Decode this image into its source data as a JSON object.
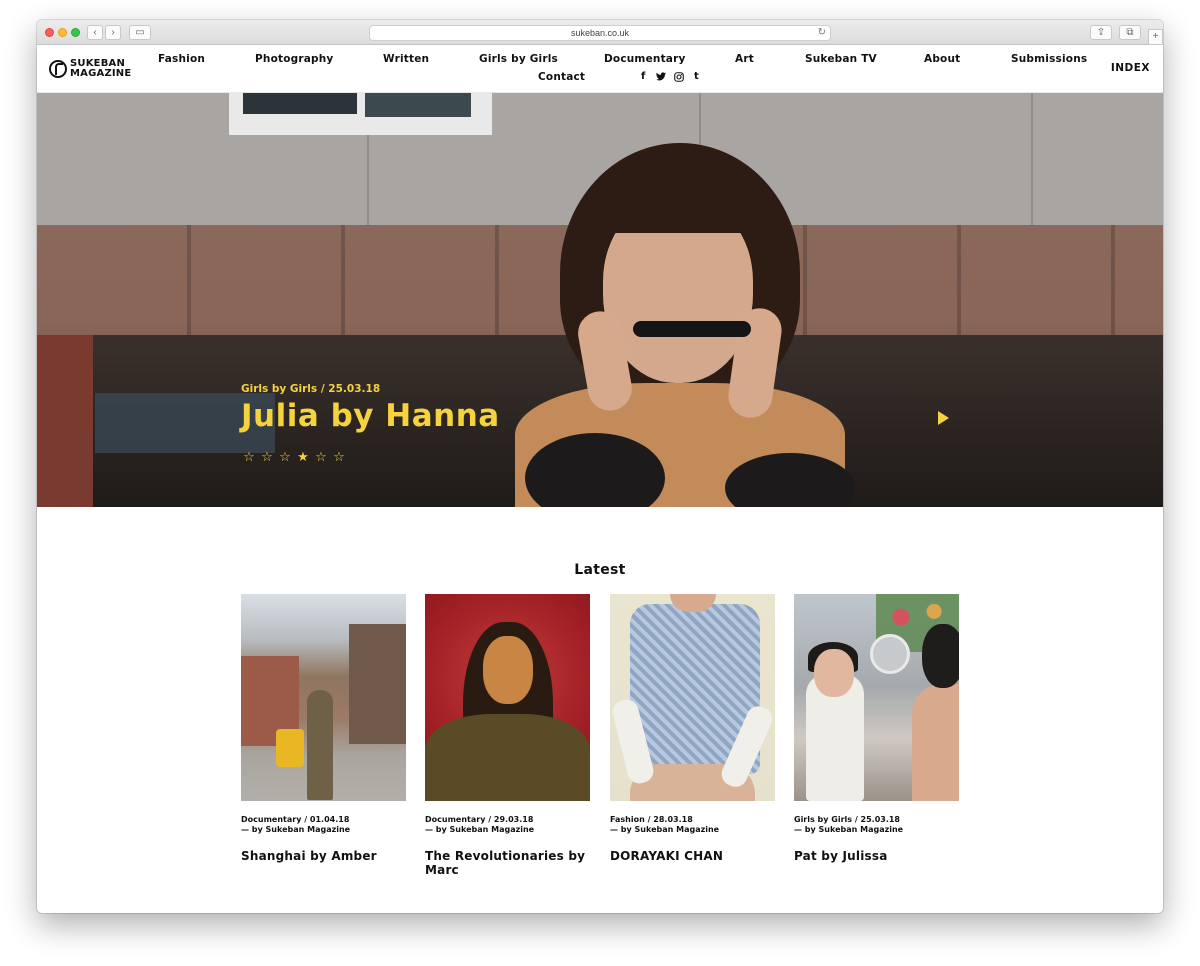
{
  "browser": {
    "url": "sukeban.co.uk"
  },
  "site": {
    "logo_line1": "SUKEBAN",
    "logo_line2": "MAGAZINE",
    "nav": [
      "Fashion",
      "Photography",
      "Written",
      "Girls by Girls",
      "Documentary",
      "Art",
      "Sukeban TV",
      "About",
      "Submissions",
      "Contact"
    ],
    "social": [
      "f",
      "twitter-bird",
      "instagram",
      "t"
    ],
    "index_label": "INDEX"
  },
  "hero": {
    "meta": "Girls by Girls / 25.03.18",
    "title": "Julia by Hanna",
    "slides_total": 6,
    "slide_active": 4,
    "accent_color": "#f5d33f"
  },
  "latest": {
    "heading": "Latest",
    "cards": [
      {
        "meta": "Documentary / 01.04.18",
        "byline": "— by Sukeban Magazine",
        "title": "Shanghai by Amber"
      },
      {
        "meta": "Documentary / 29.03.18",
        "byline": "— by Sukeban Magazine",
        "title": "The Revolutionaries by Marc"
      },
      {
        "meta": "Fashion / 28.03.18",
        "byline": "— by Sukeban Magazine",
        "title": "DORAYAKI CHAN"
      },
      {
        "meta": "Girls by Girls / 25.03.18",
        "byline": "— by Sukeban Magazine",
        "title": "Pat by Julissa"
      }
    ]
  }
}
